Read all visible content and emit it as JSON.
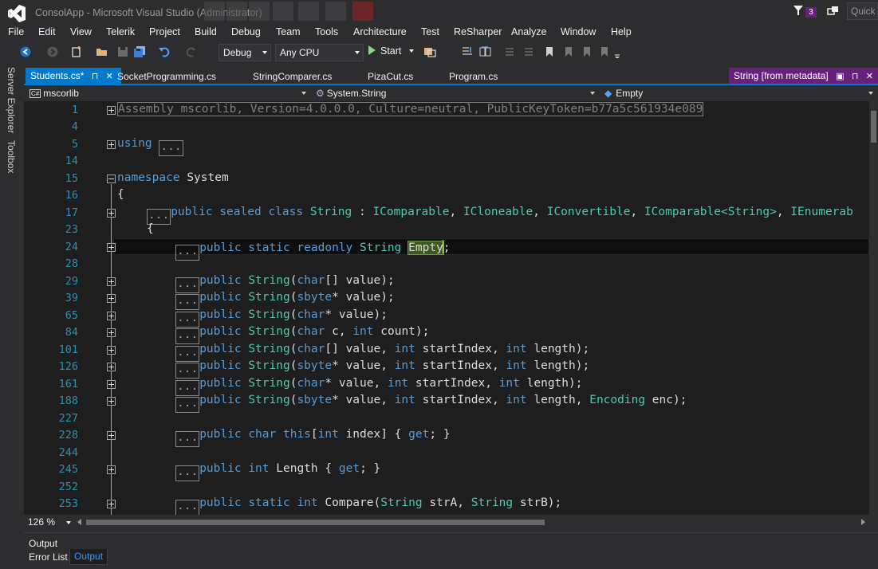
{
  "window": {
    "title": "ConsolApp - Microsoft Visual Studio (Administrator)",
    "notification_count": "3",
    "quick_launch_placeholder": "Quick"
  },
  "menu": [
    "File",
    "Edit",
    "View",
    "Telerik",
    "Project",
    "Build",
    "Debug",
    "Team",
    "Tools",
    "Architecture",
    "Test",
    "ReSharper",
    "Analyze",
    "Window",
    "Help"
  ],
  "toolbar": {
    "configuration": "Debug",
    "platform": "Any CPU",
    "start_label": "Start"
  },
  "side_tabs": [
    "Server Explorer",
    "Toolbox"
  ],
  "doc_tabs": {
    "active": "Students.cs*",
    "others": [
      "SocketProgramming.cs",
      "StringComparer.cs",
      "PizaCut.cs",
      "Program.cs"
    ],
    "preview": "String [from metadata]"
  },
  "navbar": {
    "project": "mscorlib",
    "project_icon": "C#",
    "type": "System.String",
    "member": "Empty"
  },
  "editor": {
    "line_numbers": [
      "1",
      "4",
      "5",
      "14",
      "15",
      "16",
      "17",
      "23",
      "24",
      "28",
      "29",
      "39",
      "65",
      "84",
      "101",
      "126",
      "161",
      "188",
      "227",
      "228",
      "244",
      "245",
      "252",
      "253"
    ],
    "collapsed_marker": "...",
    "assembly_line": "Assembly mscorlib, Version=4.0.0.0, Culture=neutral, PublicKeyToken=b77a5c561934e089",
    "using_kw": "using",
    "namespace_kw": "namespace",
    "namespace_name": "System",
    "open_brace": "{",
    "class_decl": {
      "public": "public",
      "sealed": "sealed",
      "class": "class",
      "name": "String",
      "colon": " : ",
      "bases": [
        "IComparable",
        "ICloneable",
        "IConvertible",
        "IComparable<String>",
        "IEnumerab"
      ]
    },
    "field_line": {
      "mods": "public static readonly",
      "type": "String",
      "name": "Empty",
      "end": ";"
    },
    "ctors": [
      "public String(char[] value);",
      "public String(sbyte* value);",
      "public String(char* value);",
      "public String(char c, int count);",
      "public String(char[] value, int startIndex, int length);",
      "public String(sbyte* value, int startIndex, int length);",
      "public String(char* value, int startIndex, int length);",
      "public String(sbyte* value, int startIndex, int length, Encoding enc);"
    ],
    "indexer": "public char this[int index] { get; }",
    "length_prop": "public int Length { get; }",
    "compare": "public static int Compare(String strA, String strB);"
  },
  "status": {
    "zoom": "126 %"
  },
  "bottom_panel": {
    "title": "Output",
    "tabs": [
      "Error List",
      "Output"
    ]
  },
  "colors": {
    "keyword": "#569cd6",
    "type": "#4ec9b0",
    "line_number": "#2b91af",
    "accent": "#007acc",
    "preview_tab": "#68217a"
  }
}
